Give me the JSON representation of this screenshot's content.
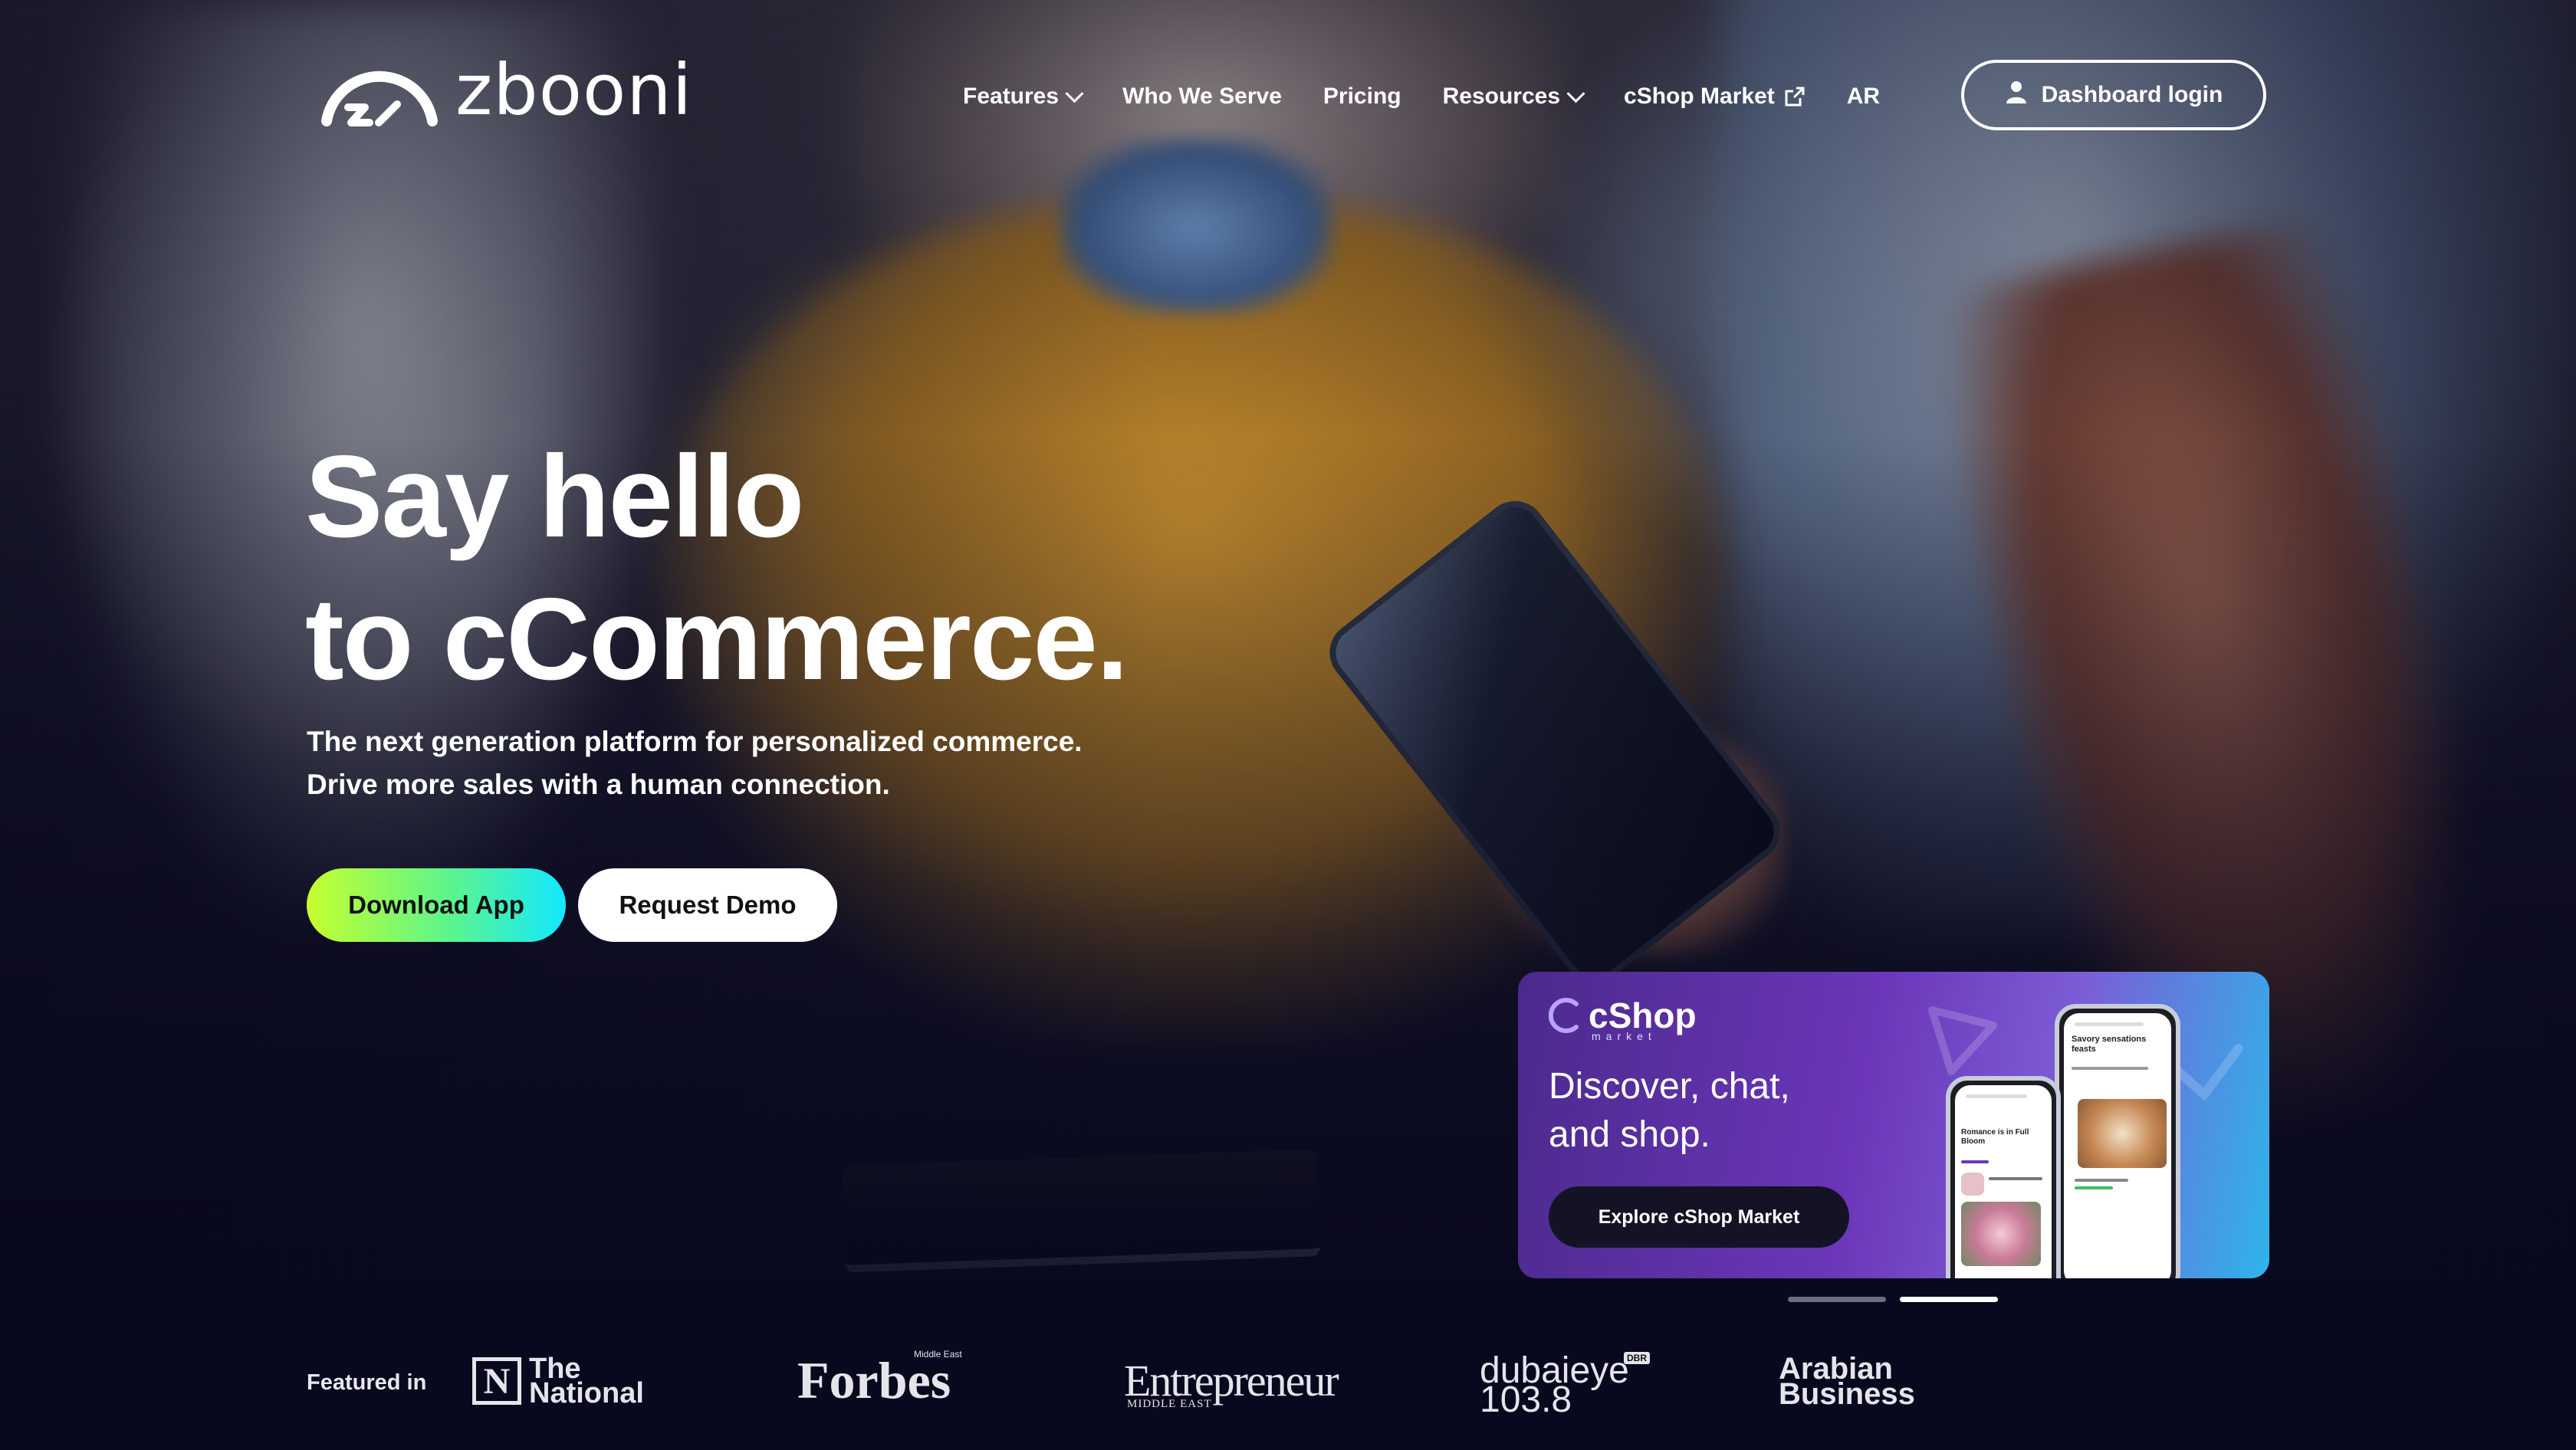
{
  "brand": {
    "name": "zbooni",
    "logo_icon": "zbooni-speedometer-icon"
  },
  "nav": {
    "items": [
      {
        "label": "Features",
        "dropdown": true
      },
      {
        "label": "Who We Serve",
        "dropdown": false
      },
      {
        "label": "Pricing",
        "dropdown": false
      },
      {
        "label": "Resources",
        "dropdown": true
      },
      {
        "label": "cShop Market",
        "dropdown": false,
        "external": true
      },
      {
        "label": "AR",
        "dropdown": false
      }
    ],
    "login_label": "Dashboard login"
  },
  "hero": {
    "title_line1": "Say hello",
    "title_line2": "to cCommerce.",
    "subtitle_line1": "The next generation platform for personalized commerce.",
    "subtitle_line2": "Drive more sales with a human connection.",
    "cta_primary": "Download App",
    "cta_secondary": "Request Demo"
  },
  "banner": {
    "logo_text": "cShop",
    "logo_sub": "market",
    "line1": "Discover, chat,",
    "line2": "and shop.",
    "button_label": "Explore cShop Market",
    "phone_back": {
      "heading": "Savory sensations feasts"
    },
    "phone_front": {
      "heading": "Romance is in Full Bloom"
    }
  },
  "slider": {
    "count": 2,
    "active_index": 1
  },
  "featured": {
    "label": "Featured in",
    "outlets": {
      "national_mark": "N",
      "national_line1": "The",
      "national_line2": "National",
      "forbes": "Forbes",
      "forbes_sub": "Middle East",
      "entrepreneur": "Entrepreneur",
      "entrepreneur_sub": "MIDDLE EAST",
      "dubai_line1": "dubaieye",
      "dubai_line2": "103.8",
      "dubai_badge": "DBR",
      "arabian_line1": "Arabian",
      "arabian_line2": "Business"
    }
  },
  "colors": {
    "cta_gradient_start": "#c6ff2e",
    "cta_gradient_end": "#12e8ff",
    "banner_start": "#4b2a8c",
    "banner_end": "#2fb4ea",
    "page_dark": "#0b0b22"
  }
}
